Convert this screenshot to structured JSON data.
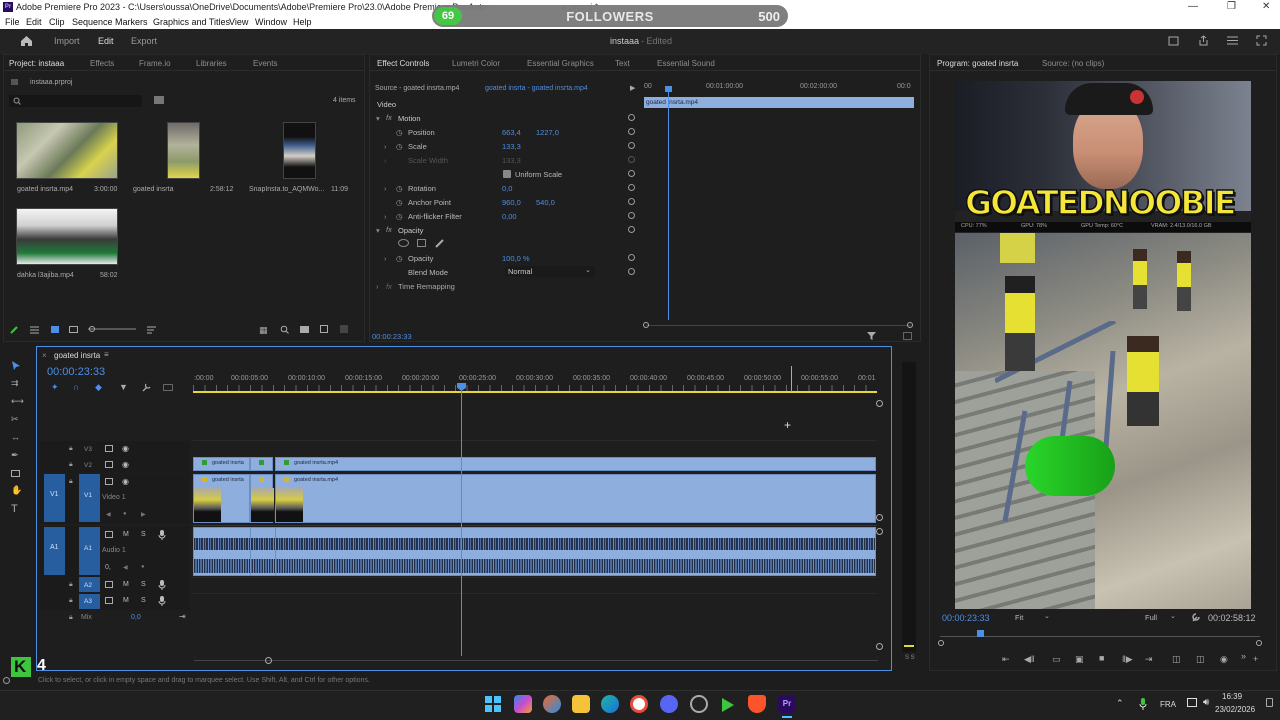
{
  "window": {
    "title": "Adobe Premiere Pro 2023 - C:\\Users\\oussa\\OneDrive\\Documents\\Adobe\\Premiere Pro\\23.0\\Adobe Premiere Pro Auto-",
    "title_tail": "a.prproj *"
  },
  "menu": [
    "File",
    "Edit",
    "Clip",
    "Sequence",
    "Markers",
    "Graphics and Titles",
    "View",
    "Window",
    "Help"
  ],
  "followers": {
    "count": "69",
    "label": "FOLLOWERS",
    "goal": "500"
  },
  "header": {
    "import": "Import",
    "edit": "Edit",
    "export": "Export",
    "project_name": "instaaa",
    "status": "- Edited"
  },
  "project_panel": {
    "tabs": [
      "Project: instaaa",
      "Effects",
      "Frame.io",
      "Libraries",
      "Events"
    ],
    "file": "instaaa.prproj",
    "item_count": "4 items",
    "items": [
      {
        "name": "goated insrta.mp4",
        "duration": "3:00:00"
      },
      {
        "name": "goated insrta",
        "duration": "2:58:12"
      },
      {
        "name": "SnapInsta.to_AQMWo...",
        "duration": "11:09"
      },
      {
        "name": "dahka l3ajiba.mp4",
        "duration": "58:02"
      }
    ]
  },
  "effect_controls": {
    "tabs": [
      "Effect Controls",
      "Lumetri Color",
      "Essential Graphics",
      "Text",
      "Essential Sound"
    ],
    "source": "Source - goated insrta.mp4",
    "clip": "goated insrta - goated insrta.mp4",
    "times": [
      "00",
      "00:01:00:00",
      "00:02:00:00",
      "00:0"
    ],
    "clip_bar": "goated insrta.mp4",
    "video_label": "Video",
    "motion": "Motion",
    "position": {
      "label": "Position",
      "x": "663,4",
      "y": "1227,0"
    },
    "scale": {
      "label": "Scale",
      "value": "133,3"
    },
    "scale_width": {
      "label": "Scale Width",
      "value": "133,3"
    },
    "uniform_scale": "Uniform Scale",
    "rotation": {
      "label": "Rotation",
      "value": "0,0"
    },
    "anchor": {
      "label": "Anchor Point",
      "x": "960,0",
      "y": "540,0"
    },
    "antiflicker": {
      "label": "Anti-flicker Filter",
      "value": "0,00"
    },
    "opacity_section": "Opacity",
    "opacity": {
      "label": "Opacity",
      "value": "100,0 %"
    },
    "blend": {
      "label": "Blend Mode",
      "value": "Normal"
    },
    "time_remap": "Time Remapping",
    "timecode": "00:00:23:33"
  },
  "program": {
    "tabs": [
      "Program: goated insrta",
      "Source: (no clips)"
    ],
    "timecode": "00:00:23:33",
    "fit": "Fit",
    "quality": "Full",
    "duration": "00:02:58:12",
    "overlay_title": "GOATEDNOOBIE",
    "stats": [
      "CPU: 77%",
      "GPU: 78%",
      "GPU Temp: 60°C",
      "VRAM: 2.4/13.0/16.0 GB"
    ]
  },
  "timeline": {
    "seq_name": "goated insrta",
    "timecode": "00:00:23:33",
    "ruler": [
      ":00:00",
      "00:00:05:00",
      "00:00:10:00",
      "00:00:15:00",
      "00:00:20:00",
      "00:00:25:00",
      "00:00:30:00",
      "00:00:35:00",
      "00:00:40:00",
      "00:00:45:00",
      "00:00:50:00",
      "00:00:55:00",
      "00:01"
    ],
    "tracks_v": [
      "V3",
      "V2",
      "V1"
    ],
    "video1": "Video 1",
    "tracks_a": [
      "A1",
      "A2",
      "A3"
    ],
    "audio1": "Audio 1",
    "mix": "Mix",
    "mix_value": "0,0",
    "v1_src": "V1",
    "a1_src": "A1",
    "clip_v2a": "goated insrta",
    "clip_v2b": "goated insrta.mp4",
    "clip_v1a": "goated insrta",
    "clip_v1b": "goated insrta.mp4",
    "audio_zero": "0,"
  },
  "status": "Click to select, or click in empty space and drag to marquee select. Use Shift, Alt, and Ctrl for other options.",
  "streamer": {
    "letter": "K",
    "count": "4"
  },
  "tray": {
    "lang": "FRA",
    "time": "16:39",
    "date": "23/02/2026"
  },
  "colors": {
    "accent": "#4d8ee6",
    "clip": "#8eaedd",
    "playhead": "#4d8ee6",
    "followers_badge": "#3fc43f"
  }
}
